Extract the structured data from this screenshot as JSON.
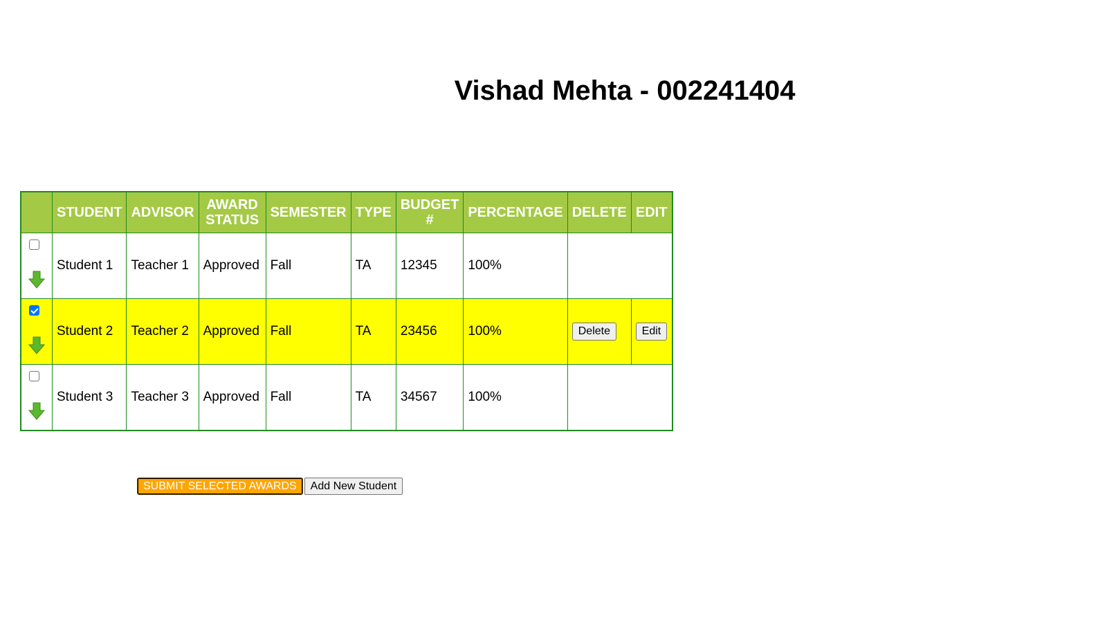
{
  "page": {
    "title": "Vishad Mehta - 002241404"
  },
  "table": {
    "headers": {
      "student": "STUDENT",
      "advisor": "ADVISOR",
      "award_status_line1": "AWARD",
      "award_status_line2": "STATUS",
      "semester": "SEMESTER",
      "type": "TYPE",
      "budget_line1": "BUDGET",
      "budget_line2": "#",
      "percentage": "PERCENTAGE",
      "delete": "DELETE",
      "edit": "EDIT"
    },
    "rows": [
      {
        "checked": false,
        "student": "Student 1",
        "advisor": "Teacher 1",
        "status": "Approved",
        "semester": "Fall",
        "type": "TA",
        "budget": "12345",
        "percentage": "100%"
      },
      {
        "checked": true,
        "student": "Student 2",
        "advisor": "Teacher 2",
        "status": "Approved",
        "semester": "Fall",
        "type": "TA",
        "budget": "23456",
        "percentage": "100%",
        "delete_label": "Delete",
        "edit_label": "Edit"
      },
      {
        "checked": false,
        "student": "Student 3",
        "advisor": "Teacher 3",
        "status": "Approved",
        "semester": "Fall",
        "type": "TA",
        "budget": "34567",
        "percentage": "100%"
      }
    ],
    "colors": {
      "header_bg": "#a4c944",
      "border": "#1f8a1f",
      "selected_row_bg": "#ffff00",
      "arrow": "#5cb82e"
    }
  },
  "actions": {
    "submit_label": "SUBMIT SELECTED AWARDS",
    "add_label": "Add New Student",
    "submit_color": "#ffa500"
  }
}
